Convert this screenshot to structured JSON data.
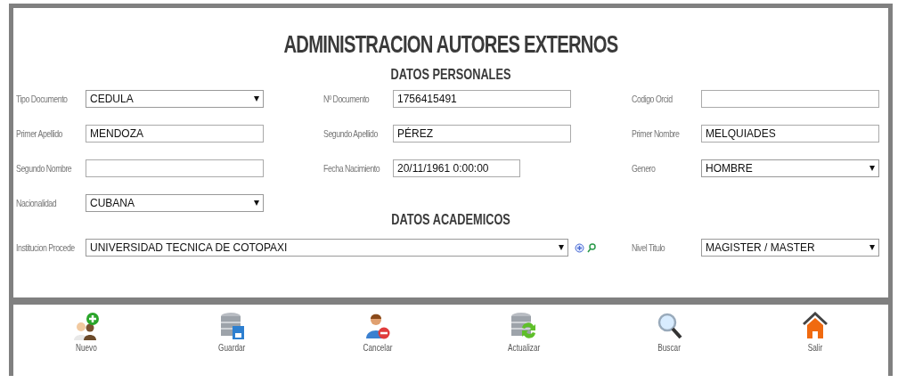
{
  "title": "ADMINISTRACION AUTORES EXTERNOS",
  "personal": {
    "heading": "DATOS PERSONALES",
    "fields": [
      {
        "label": "Tipo Documento",
        "kind": "select",
        "value": "CEDULA"
      },
      {
        "label": "Nº Documento",
        "kind": "text",
        "value": "1756415491"
      },
      {
        "label": "Codigo Orcid",
        "kind": "text"
      },
      {
        "label": "Primer Apellido",
        "kind": "text",
        "value": "MENDOZA"
      },
      {
        "label": "Segundo Apellido",
        "kind": "text",
        "value": "PÉREZ"
      },
      {
        "label": "Primer Nombre",
        "kind": "text",
        "value": "MELQUIADES"
      },
      {
        "label": "Segundo Nombre",
        "kind": "text"
      },
      {
        "label": "Fecha Nacimiento",
        "kind": "date",
        "value": "20/11/1961 0:00:00"
      },
      {
        "label": "Genero",
        "kind": "select",
        "value": "HOMBRE"
      },
      {
        "label": "Nacionalidad",
        "kind": "select",
        "value": "CUBANA"
      }
    ]
  },
  "academic": {
    "heading": "DATOS ACADEMICOS",
    "fields": [
      {
        "label": "Institucion Procede",
        "kind": "lookup",
        "value": "UNIVERSIDAD TECNICA DE COTOPAXI"
      },
      {
        "label": "Nivel Titulo",
        "kind": "select",
        "value": "MAGISTER / MASTER"
      }
    ]
  },
  "toolbar": [
    {
      "label": "Nuevo",
      "kind": "new"
    },
    {
      "label": "Guardar",
      "kind": "save"
    },
    {
      "label": "Cancelar",
      "kind": "cancel"
    },
    {
      "label": "Actualizar",
      "kind": "refresh"
    },
    {
      "label": "Buscar",
      "kind": "search"
    },
    {
      "label": "Salir",
      "kind": "home"
    }
  ]
}
